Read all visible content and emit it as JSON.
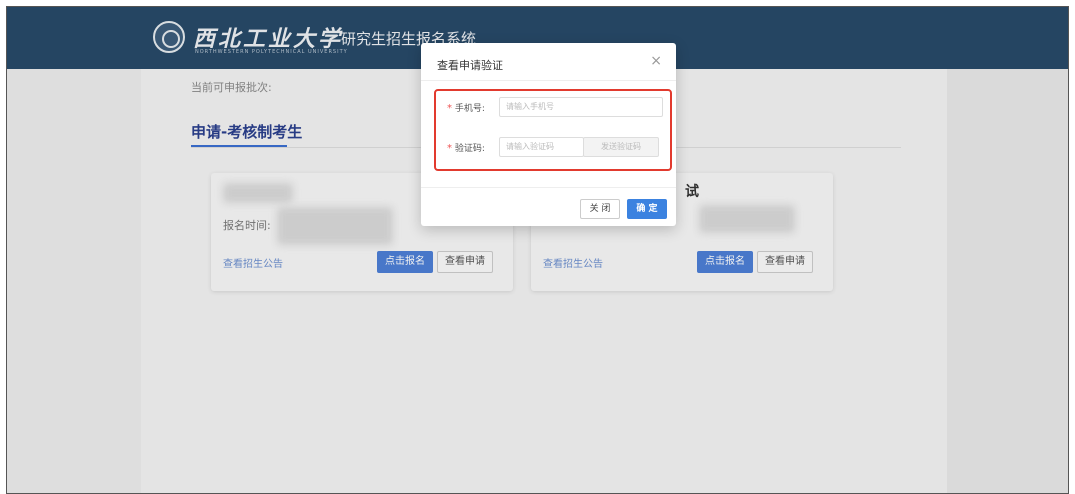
{
  "header": {
    "logo_cn": "西北工业大学",
    "logo_en": "NORTHWESTERN POLYTECHNICAL UNIVERSITY",
    "system_title": "研究生招生报名系统"
  },
  "main": {
    "batch_hint": "当前可申报批次:",
    "section_title": "申请-考核制考生",
    "cards": [
      {
        "time_label": "报名时间:",
        "notice_link": "查看招生公告",
        "signup_button": "点击报名",
        "view_button": "查看申请"
      },
      {
        "title_fragment": "试",
        "notice_link": "查看招生公告",
        "signup_button": "点击报名",
        "view_button": "查看申请"
      }
    ]
  },
  "dialog": {
    "title": "查看申请验证",
    "close_symbol": "×",
    "required_mark": "*",
    "phone_label": "手机号:",
    "phone_placeholder": "请输入手机号",
    "code_label": "验证码:",
    "code_placeholder": "请输入验证码",
    "send_code_button": "发送验证码",
    "cancel_button": "关 闭",
    "confirm_button": "确 定"
  },
  "colors": {
    "header_bg": "#284a69",
    "primary": "#3b82e0",
    "highlight_border": "#e23a2e"
  }
}
